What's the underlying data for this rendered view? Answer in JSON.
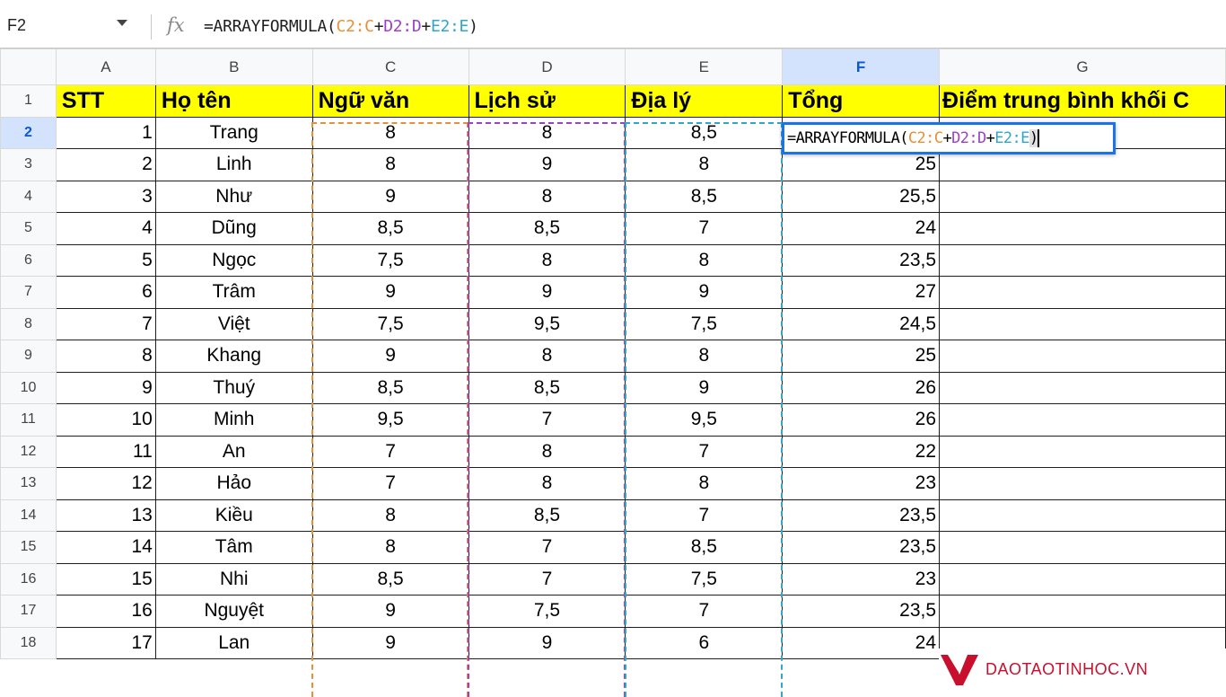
{
  "formula_bar": {
    "name_box": "F2",
    "fx_label": "fx",
    "formula_prefix": "=ARRAYFORMULA(",
    "ref_c": "C2:C",
    "plus1": "+",
    "ref_d": "D2:D",
    "plus2": "+",
    "ref_e": "E2:E",
    "formula_suffix": ")"
  },
  "columns": [
    "A",
    "B",
    "C",
    "D",
    "E",
    "F",
    "G"
  ],
  "selected_column": "F",
  "selected_row": 2,
  "headers": {
    "row_number": "1",
    "stt": "STT",
    "name": "Họ tên",
    "lit": "Ngữ văn",
    "hist": "Lịch sử",
    "geo": "Địa lý",
    "total": "Tổng",
    "avg": "Điểm trung bình khối C"
  },
  "rows": [
    {
      "r": "2",
      "stt": "1",
      "name": "Trang",
      "lit": "8",
      "hist": "8",
      "geo": "8,5",
      "total": ""
    },
    {
      "r": "3",
      "stt": "2",
      "name": "Linh",
      "lit": "8",
      "hist": "9",
      "geo": "8",
      "total": "25"
    },
    {
      "r": "4",
      "stt": "3",
      "name": "Như",
      "lit": "9",
      "hist": "8",
      "geo": "8,5",
      "total": "25,5"
    },
    {
      "r": "5",
      "stt": "4",
      "name": "Dũng",
      "lit": "8,5",
      "hist": "8,5",
      "geo": "7",
      "total": "24"
    },
    {
      "r": "6",
      "stt": "5",
      "name": "Ngọc",
      "lit": "7,5",
      "hist": "8",
      "geo": "8",
      "total": "23,5"
    },
    {
      "r": "7",
      "stt": "6",
      "name": "Trâm",
      "lit": "9",
      "hist": "9",
      "geo": "9",
      "total": "27"
    },
    {
      "r": "8",
      "stt": "7",
      "name": "Việt",
      "lit": "7,5",
      "hist": "9,5",
      "geo": "7,5",
      "total": "24,5"
    },
    {
      "r": "9",
      "stt": "8",
      "name": "Khang",
      "lit": "9",
      "hist": "8",
      "geo": "8",
      "total": "25"
    },
    {
      "r": "10",
      "stt": "9",
      "name": "Thuý",
      "lit": "8,5",
      "hist": "8,5",
      "geo": "9",
      "total": "26"
    },
    {
      "r": "11",
      "stt": "10",
      "name": "Minh",
      "lit": "9,5",
      "hist": "7",
      "geo": "9,5",
      "total": "26"
    },
    {
      "r": "12",
      "stt": "11",
      "name": "An",
      "lit": "7",
      "hist": "8",
      "geo": "7",
      "total": "22"
    },
    {
      "r": "13",
      "stt": "12",
      "name": "Hảo",
      "lit": "7",
      "hist": "8",
      "geo": "8",
      "total": "23"
    },
    {
      "r": "14",
      "stt": "13",
      "name": "Kiều",
      "lit": "8",
      "hist": "8,5",
      "geo": "7",
      "total": "23,5"
    },
    {
      "r": "15",
      "stt": "14",
      "name": "Tâm",
      "lit": "8",
      "hist": "7",
      "geo": "8,5",
      "total": "23,5"
    },
    {
      "r": "16",
      "stt": "15",
      "name": "Nhi",
      "lit": "8,5",
      "hist": "7",
      "geo": "7,5",
      "total": "23"
    },
    {
      "r": "17",
      "stt": "16",
      "name": "Nguyệt",
      "lit": "9",
      "hist": "7,5",
      "geo": "7",
      "total": "23,5"
    },
    {
      "r": "18",
      "stt": "17",
      "name": "Lan",
      "lit": "9",
      "hist": "9",
      "geo": "6",
      "total": "24"
    }
  ],
  "watermark": "DAOTAOTINHOC.VN",
  "colors": {
    "header_fill": "#ffff00",
    "range_c": "#e69138",
    "range_d": "#9c40c9",
    "range_e": "#30a6c9",
    "active_border": "#1a73e8",
    "brand": "#c8102e"
  }
}
